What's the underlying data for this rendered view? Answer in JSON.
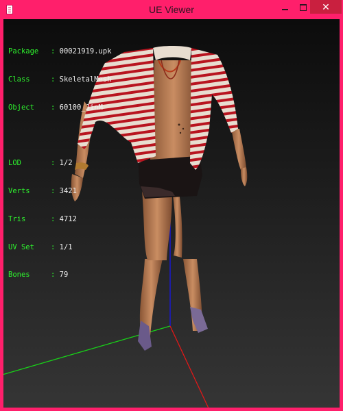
{
  "window": {
    "title": "UE Viewer",
    "controls": {
      "minimize": "minimize",
      "maximize": "maximize",
      "close": "✕"
    },
    "frame_color": "#ff1f6b",
    "close_color": "#c9203f"
  },
  "info": {
    "label_color": "#2ef52e",
    "value_color": "#f2f2f2",
    "rows": [
      {
        "key": "Package",
        "sep": ":",
        "value": "00021919.upk"
      },
      {
        "key": "Class",
        "sep": ":",
        "value": "SkeletalMesh"
      },
      {
        "key": "Object",
        "sep": ":",
        "value": "60100_JinM"
      },
      {
        "key": "LOD",
        "sep": ":",
        "value": "1/2"
      },
      {
        "key": "Verts",
        "sep": ":",
        "value": "3421"
      },
      {
        "key": "Tris",
        "sep": ":",
        "value": "4712"
      },
      {
        "key": "UV Set",
        "sep": ":",
        "value": "1/1"
      },
      {
        "key": "Bones",
        "sep": ":",
        "value": "79"
      }
    ]
  },
  "viewport": {
    "background_top": "#0c0c0c",
    "background_bottom": "#353535",
    "axes": {
      "x_color": "#e01818",
      "y_color": "#18d018",
      "z_color": "#1818d0"
    }
  }
}
